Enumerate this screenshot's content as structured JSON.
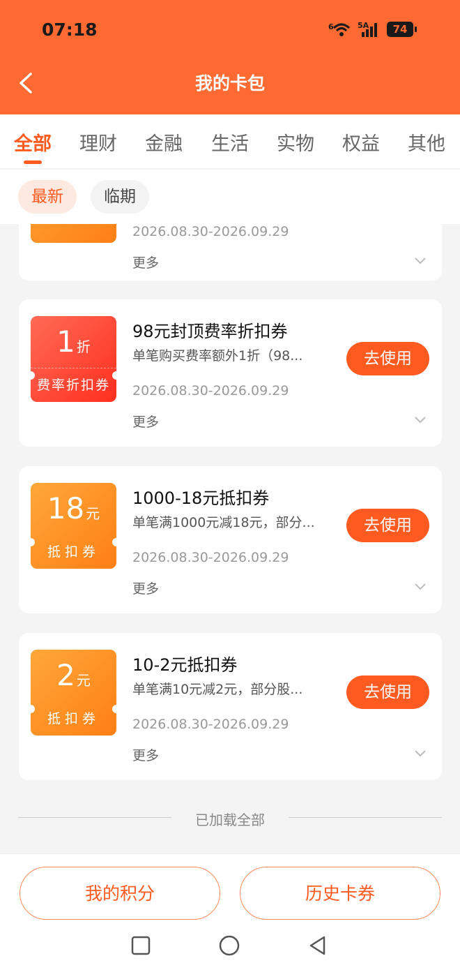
{
  "status": {
    "time": "07:18",
    "battery": "74",
    "network": "5A",
    "wifi": "6"
  },
  "nav": {
    "title": "我的卡包"
  },
  "tabs": [
    "全部",
    "理财",
    "金融",
    "生活",
    "实物",
    "权益",
    "其他"
  ],
  "filters": [
    "最新",
    "临期"
  ],
  "partial_card": {
    "date": "2026.08.30-2026.09.29",
    "more": "更多"
  },
  "coupons": [
    {
      "value": "1",
      "unit": "折",
      "label": "费率折扣券",
      "title": "98元封顶费率折扣券",
      "desc": "单笔购买费率额外1折（98...",
      "date": "2026.08.30-2026.09.29",
      "more": "更多",
      "action": "去使用"
    },
    {
      "value": "18",
      "unit": "元",
      "label": "抵扣券",
      "title": "1000-18元抵扣券",
      "desc": "单笔满1000元减18元，部分...",
      "date": "2026.08.30-2026.09.29",
      "more": "更多",
      "action": "去使用"
    },
    {
      "value": "2",
      "unit": "元",
      "label": "抵扣券",
      "title": "10-2元抵扣券",
      "desc": "单笔满10元减2元，部分股...",
      "date": "2026.08.30-2026.09.29",
      "more": "更多",
      "action": "去使用"
    }
  ],
  "end_text": "已加载全部",
  "bottom": {
    "points": "我的积分",
    "history": "历史卡券"
  },
  "colors": {
    "brand": "#ff6a32",
    "accent": "#ff5a1f",
    "badge_red": "#ff3b2a",
    "badge_orange": "#ff8c1f"
  }
}
